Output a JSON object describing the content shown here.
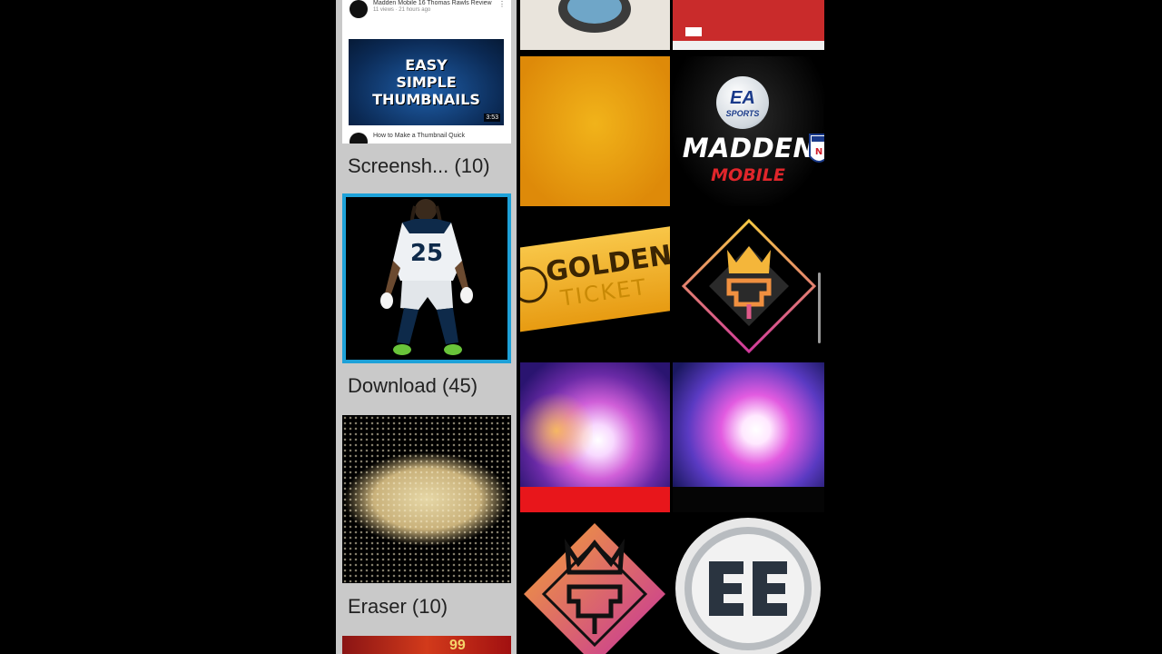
{
  "albums": [
    {
      "label": "Screensh... (10)"
    },
    {
      "label": "Download (45)"
    },
    {
      "label": "Eraser (10)"
    }
  ],
  "screenshot_thumb": {
    "video1_title": "Madden Mobile 16 Thomas Rawls Review",
    "video1_meta": "11 views · 21 hours ago",
    "video_lines": [
      "EASY",
      "SIMPLE",
      "THUMBNAILS"
    ],
    "duration": "3:53",
    "video2_title": "How to Make a Thumbnail Quick"
  },
  "player_thumb": {
    "jersey_number": "25"
  },
  "partial_thumb": {
    "text": "99"
  },
  "grid": {
    "madden_badge_top": "EA",
    "madden_badge_bottom": "SPORTS",
    "madden_title": "MADDEN",
    "madden_subtitle": "MOBILE",
    "golden_title": "GOLDEN",
    "golden_subtitle": "TICKET"
  },
  "colors": {
    "selected_border": "#1da1d8",
    "album_background": "#c9c9c9"
  }
}
